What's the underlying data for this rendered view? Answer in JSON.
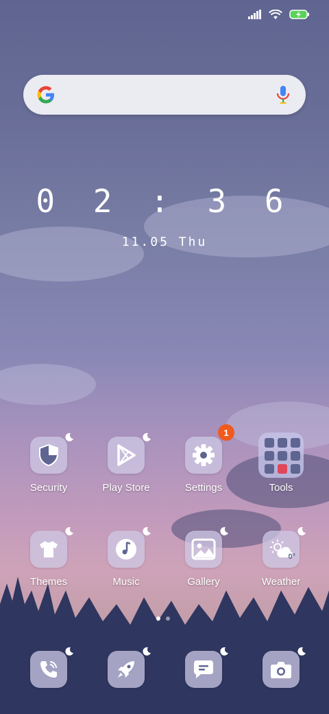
{
  "status": {
    "icons": [
      "signal-icon",
      "wifi-icon",
      "battery-charging-icon"
    ]
  },
  "search": {
    "icons": [
      "google-logo",
      "mic-icon"
    ]
  },
  "clock": {
    "time": "0 2 : 3 6",
    "date": "11.05 Thu"
  },
  "apps_row1": [
    {
      "label": "Security",
      "icon": "shield-icon"
    },
    {
      "label": "Play Store",
      "icon": "play-icon"
    },
    {
      "label": "Settings",
      "icon": "gear-icon",
      "badge": "1"
    },
    {
      "label": "Tools",
      "icon": "folder"
    }
  ],
  "apps_row2": [
    {
      "label": "Themes",
      "icon": "tshirt-icon"
    },
    {
      "label": "Music",
      "icon": "music-icon"
    },
    {
      "label": "Gallery",
      "icon": "image-icon"
    },
    {
      "label": "Weather",
      "icon": "weather-icon",
      "temp": "0°"
    }
  ],
  "dock": [
    "phone-icon",
    "rocket-icon",
    "message-icon",
    "camera-icon"
  ],
  "colors": {
    "accent_badge": "#f05a1e",
    "icon_glyph": "#5f6591"
  }
}
